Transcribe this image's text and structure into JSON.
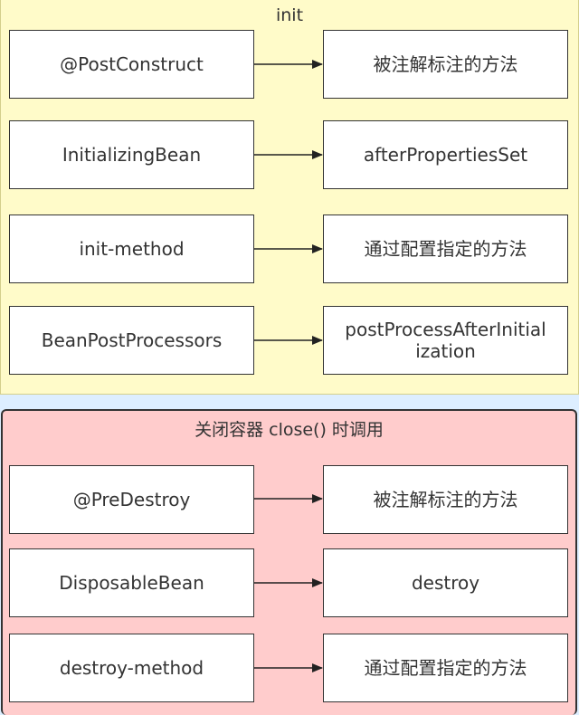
{
  "init": {
    "title": "init",
    "rows": [
      {
        "left": "@PostConstruct",
        "right": "被注解标注的方法"
      },
      {
        "left": "InitializingBean",
        "right": "afterPropertiesSet"
      },
      {
        "left": "init-method",
        "right": "通过配置指定的方法"
      },
      {
        "left": "BeanPostProcessors",
        "right_line1": "postProcessAfterInitial",
        "right_line2": "ization"
      }
    ]
  },
  "close": {
    "title": "关闭容器 close() 时调用",
    "rows": [
      {
        "left": "@PreDestroy",
        "right": "被注解标注的方法"
      },
      {
        "left": "DisposableBean",
        "right": "destroy"
      },
      {
        "left": "destroy-method",
        "right": "通过配置指定的方法"
      }
    ]
  },
  "colors": {
    "init_background": "#fffbc9",
    "close_background": "#ffcccc",
    "page_background": "#ddeeff",
    "box_border": "#333333"
  }
}
